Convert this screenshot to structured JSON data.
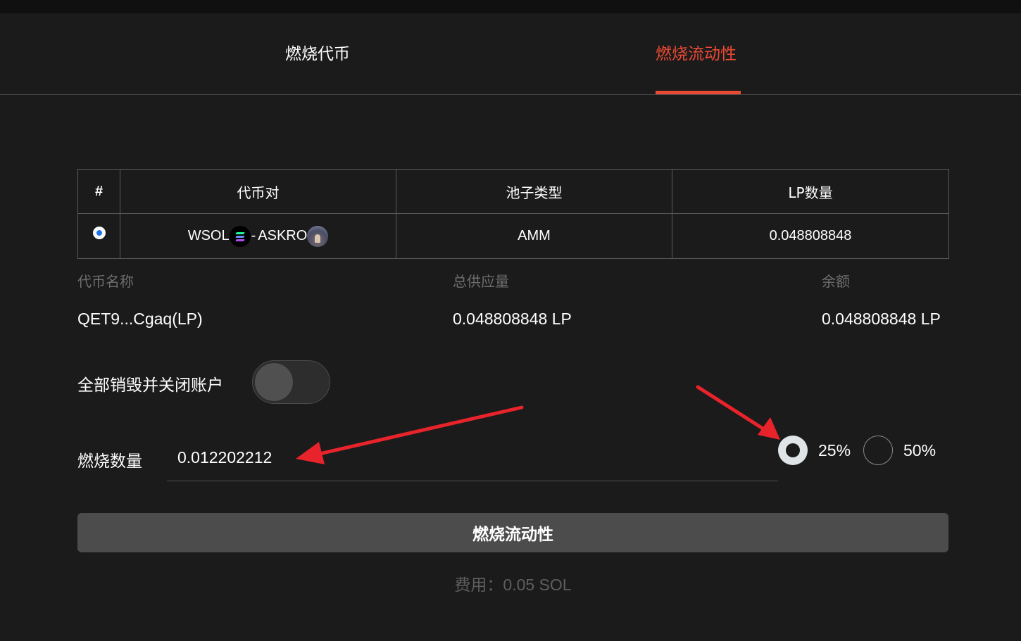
{
  "tabs": {
    "burn_token": "燃烧代币",
    "burn_liquidity": "燃烧流动性",
    "active": "burn_liquidity",
    "active_color": "#ea4a33"
  },
  "table": {
    "headers": [
      "#",
      "代币对",
      "池子类型",
      "LP数量"
    ],
    "rows": [
      {
        "selected": true,
        "token_a": "WSOL",
        "separator": "-",
        "token_b": "ASKRO",
        "token_a_icon": "solana-icon",
        "token_b_icon": "askro-icon",
        "pool_type": "AMM",
        "lp_amount": "0.048808848"
      }
    ]
  },
  "info": {
    "token_name_label": "代币名称",
    "token_name": "QET9...Cgaq(LP)",
    "total_supply_label": "总供应量",
    "total_supply": "0.048808848 LP",
    "balance_label": "余额",
    "balance": "0.048808848 LP"
  },
  "close_account": {
    "label": "全部销毁并关闭账户",
    "enabled": false
  },
  "burn_amount": {
    "label": "燃烧数量",
    "value": "0.012202212",
    "percent_options": [
      "25%",
      "50%"
    ],
    "selected_percent": "25%"
  },
  "burn_button_label": "燃烧流动性",
  "fee_text": "费用：0.05 SOL",
  "annotation_color": "#e8232b"
}
